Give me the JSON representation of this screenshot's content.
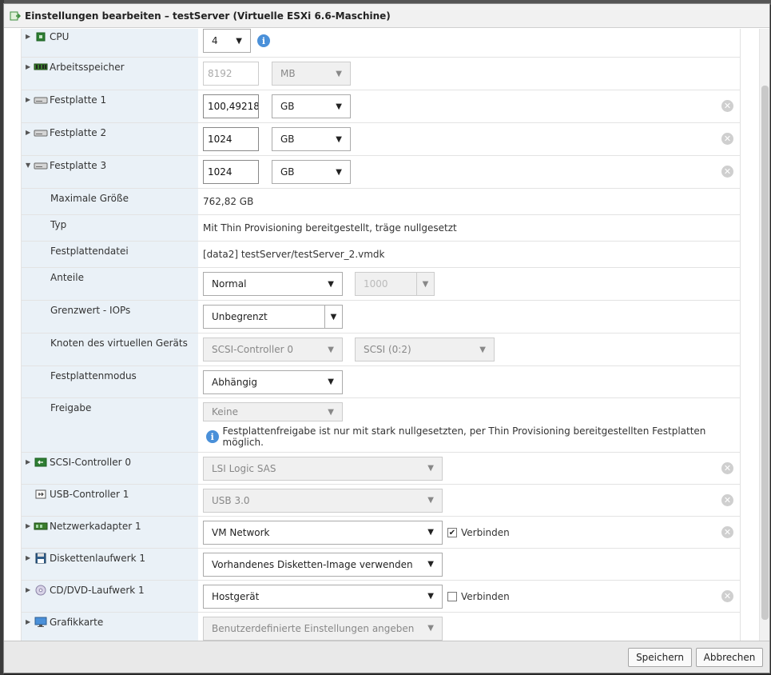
{
  "dialog": {
    "title": "Einstellungen bearbeiten – testServer (Virtuelle ESXi 6.6-Maschine)"
  },
  "rows": {
    "cpu": {
      "label": "CPU",
      "value": "4"
    },
    "memory": {
      "label": "Arbeitsspeicher",
      "value": "8192",
      "unit": "MB"
    },
    "disk1": {
      "label": "Festplatte 1",
      "value": "100,49218",
      "unit": "GB"
    },
    "disk2": {
      "label": "Festplatte 2",
      "value": "1024",
      "unit": "GB"
    },
    "disk3": {
      "label": "Festplatte 3",
      "value": "1024",
      "unit": "GB"
    },
    "max_size": {
      "label": "Maximale Größe",
      "value": "762,82 GB"
    },
    "type": {
      "label": "Typ",
      "value": "Mit Thin Provisioning bereitgestellt, träge nullgesetzt"
    },
    "disk_file": {
      "label": "Festplattendatei",
      "value": "[data2] testServer/testServer_2.vmdk"
    },
    "shares": {
      "label": "Anteile",
      "value": "Normal",
      "amount": "1000"
    },
    "iops": {
      "label": "Grenzwert - IOPs",
      "value": "Unbegrenzt"
    },
    "vdev_node": {
      "label": "Knoten des virtuellen Geräts",
      "controller": "SCSI-Controller 0",
      "slot": "SCSI (0:2)"
    },
    "disk_mode": {
      "label": "Festplattenmodus",
      "value": "Abhängig"
    },
    "sharing": {
      "label": "Freigabe",
      "value": "Keine",
      "info": "Festplattenfreigabe ist nur mit stark nullgesetzten, per Thin Provisioning bereitgestellten Festplatten möglich."
    },
    "scsi": {
      "label": "SCSI-Controller 0",
      "value": "LSI Logic SAS"
    },
    "usb": {
      "label": "USB-Controller 1",
      "value": "USB 3.0"
    },
    "net": {
      "label": "Netzwerkadapter 1",
      "value": "VM Network",
      "connect": "Verbinden"
    },
    "floppy": {
      "label": "Diskettenlaufwerk 1",
      "value": "Vorhandenes Disketten-Image verwenden"
    },
    "cdrom": {
      "label": "CD/DVD-Laufwerk 1",
      "value": "Hostgerät",
      "connect": "Verbinden"
    },
    "gpu": {
      "label": "Grafikkarte",
      "value": "Benutzerdefinierte Einstellungen angeben"
    }
  },
  "footer": {
    "save": "Speichern",
    "cancel": "Abbrechen"
  },
  "colors": {
    "label_bg": "#eaf1f7",
    "info_blue": "#4a90d9",
    "footer_bg": "#e9e9e9"
  }
}
